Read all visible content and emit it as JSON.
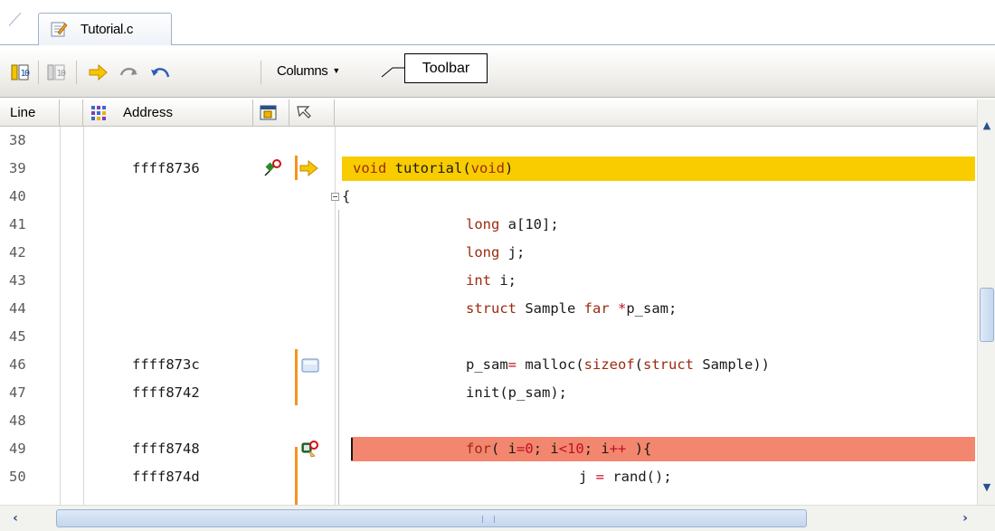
{
  "tab": {
    "label": "Tutorial.c",
    "icon": "source-file-icon"
  },
  "toolbar": {
    "columns_label": "Columns",
    "icons": [
      "go-to-address-icon",
      "go-to-source-icon",
      "show-current-pc-icon",
      "step-forward-icon",
      "step-back-icon"
    ],
    "callout": "Toolbar"
  },
  "columns": {
    "line": "Line",
    "address": "Address"
  },
  "rows": [
    {
      "line": "38",
      "address": "",
      "code": ""
    },
    {
      "line": "39",
      "address": "ffff8736",
      "code": "void tutorial(void)"
    },
    {
      "line": "40",
      "address": "",
      "code": "{"
    },
    {
      "line": "41",
      "address": "",
      "code": "long a[10];"
    },
    {
      "line": "42",
      "address": "",
      "code": "long j;"
    },
    {
      "line": "43",
      "address": "",
      "code": "int i;"
    },
    {
      "line": "44",
      "address": "",
      "code": "struct Sample far *p_sam;"
    },
    {
      "line": "45",
      "address": "",
      "code": ""
    },
    {
      "line": "46",
      "address": "ffff873c",
      "code": "p_sam= malloc(sizeof(struct Sample))"
    },
    {
      "line": "47",
      "address": "ffff8742",
      "code": "init(p_sam);"
    },
    {
      "line": "48",
      "address": "",
      "code": ""
    },
    {
      "line": "49",
      "address": "ffff8748",
      "code": "for( i=0; i<10; i++ ){"
    },
    {
      "line": "50",
      "address": "ffff874d",
      "code": "j = rand();"
    }
  ],
  "code_tokens": {
    "r39": {
      "a": "void",
      "b": " tutorial(",
      "c": "void",
      "d": ")"
    },
    "r41": {
      "a": "long",
      "b": " a[10];"
    },
    "r42": {
      "a": "long",
      "b": " j;"
    },
    "r43": {
      "a": "int",
      "b": " i;"
    },
    "r44": {
      "a": "struct",
      "b": " Sample ",
      "c": "far",
      "d": " ",
      "e": "*",
      "f": "p_sam;"
    },
    "r46": {
      "a": "p_sam",
      "b": "=",
      "c": " malloc(",
      "d": "sizeof",
      "e": "(",
      "f": "struct",
      "g": " Sample))"
    },
    "r47": {
      "a": "init(p_sam);"
    },
    "r49": {
      "a": "for",
      "b": "( i",
      "c": "=",
      "d": "0",
      "e": "; i",
      "f": "<",
      "g": "10",
      "h": "; i",
      "i": "++",
      "j": " ){"
    },
    "r50": {
      "a": "j ",
      "b": "=",
      "c": " rand();"
    }
  },
  "colors": {
    "current_line_highlight": "#f9cc00",
    "breakpoint_highlight": "#f3866e",
    "keyword": "#9c2a10",
    "event_marker": "#f5941e"
  }
}
